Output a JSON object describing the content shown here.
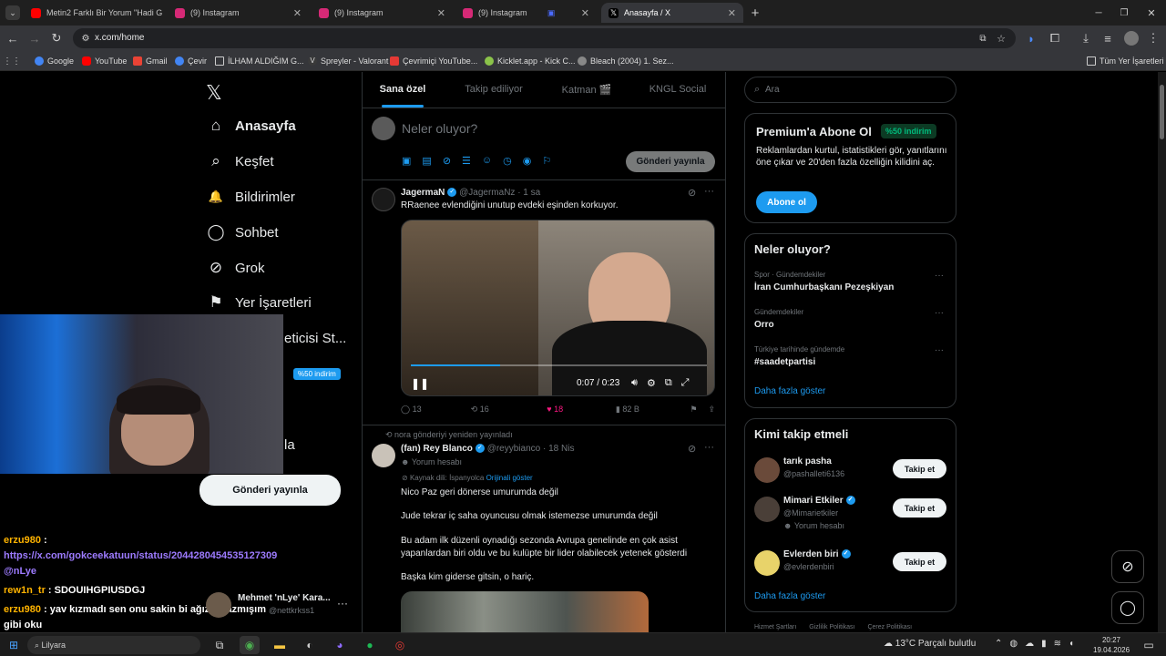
{
  "browser": {
    "tabs": [
      {
        "title": "Metin2 Farklı Bir Yorum \"Hadi G",
        "color": "#ff0000"
      },
      {
        "title": "(9) Instagram",
        "color": "#d62976"
      },
      {
        "title": "(9) Instagram",
        "color": "#d62976"
      },
      {
        "title": "(9) Instagram",
        "color": "#d62976"
      },
      {
        "title": "Anasayfa / X",
        "color": "#000000"
      }
    ],
    "url": "x.com/home",
    "bookmarks": [
      "Google",
      "YouTube",
      "Gmail",
      "Çevir",
      "İLHAM ALDIĞIM G...",
      "Spreyler - Valorant",
      "Çevrimiçi YouTube...",
      "Kicklet.app - Kick C...",
      "Bleach (2004) 1. Sez..."
    ],
    "all_bookmarks": "Tüm Yer İşaretleri"
  },
  "sidebar": {
    "logo": "𝕏",
    "items": [
      {
        "label": "Anasayfa",
        "icon": "⌂"
      },
      {
        "label": "Keşfet",
        "icon": "⌕"
      },
      {
        "label": "Bildirimler",
        "icon": "🔔"
      },
      {
        "label": "Sohbet",
        "icon": "◯"
      },
      {
        "label": "Grok",
        "icon": "⊘"
      },
      {
        "label": "Yer İşaretleri",
        "icon": "⚑"
      }
    ],
    "partial_item": "eticisi St...",
    "discount_badge": "%50 indirim",
    "partial_profile": "la",
    "post_button": "Gönderi yayınla"
  },
  "feed_tabs": [
    "Sana özel",
    "Takip ediliyor",
    "Katman 🎬",
    "KNGL Social"
  ],
  "composer": {
    "placeholder": "Neler oluyor?",
    "post_button": "Gönderi yayınla"
  },
  "tweet1": {
    "name": "JagermaN",
    "handle": "@JagermaNz",
    "time": "· 1 sa",
    "text": "RRaenee evlendiğini unutup evdeki eşinden korkuyor.",
    "video_time": "0:07 / 0:23",
    "progress": 0.3,
    "replies": "13",
    "retweets": "16",
    "likes": "18",
    "views": "82 B"
  },
  "tweet2": {
    "retweeted_by": "nora gönderiyi yeniden yayınladı",
    "name": "(fan) Rey Blanco",
    "handle": "@reyybianco",
    "time": "· 18 Nis",
    "badge": "Yorum hesabı",
    "source_lang": "Kaynak dili: İspanyolca",
    "show_original": "Orijinali göster",
    "lines": [
      "Nico Paz geri dönerse umurumda değil",
      "Jude tekrar iç saha oyuncusu olmak istemezse umurumda değil",
      "Bu adam ilk düzenli oynadığı sezonda Avrupa genelinde en çok asist yapanlardan biri oldu ve bu kulüpte bir lider olabilecek yetenek gösterdi",
      "Başka kim giderse gitsin, o hariç."
    ]
  },
  "right": {
    "search_placeholder": "Ara",
    "premium": {
      "title": "Premium'a Abone Ol",
      "badge": "%50 indirim",
      "text": "Reklamlardan kurtul, istatistikleri gör, yanıtlarını öne çıkar ve 20'den fazla özelliğin kilidini aç.",
      "button": "Abone ol"
    },
    "trends": {
      "title": "Neler oluyor?",
      "items": [
        {
          "category": "Spor · Gündemdekiler",
          "name": "İran Cumhurbaşkanı Pezeşkiyan"
        },
        {
          "category": "Gündemdekiler",
          "name": "Orro"
        },
        {
          "category": "Türkiye tarihinde gündemde",
          "name": "#saadetpartisi"
        }
      ],
      "more": "Daha fazla göster"
    },
    "follow": {
      "title": "Kimi takip etmeli",
      "items": [
        {
          "name": "tarık pasha",
          "handle": "@pashalleti6136",
          "sub": ""
        },
        {
          "name": "Mimari Etkiler",
          "handle": "@Mimarietkiler",
          "sub": "Yorum hesabı"
        },
        {
          "name": "Evlerden biri",
          "handle": "@evlerdenbiri",
          "sub": ""
        }
      ],
      "button": "Takip et",
      "more": "Daha fazla göster"
    },
    "footer": [
      "Hizmet Şartları",
      "Gizlilik Politikası",
      "Çerez Politikası"
    ]
  },
  "profile_popup": {
    "name": "Mehmet 'nLye' Kara...",
    "handle": "@nettkrkss1"
  },
  "chat": [
    {
      "user": "erzu980",
      "color": "#ffb300",
      "text": "",
      "link": "https://x.com/gokceekatuun/status/2044280454535127309 @nLye"
    },
    {
      "user": "rew1n_tr",
      "color": "#ffb300",
      "text": "SDOUIHGPIUSDGJ",
      "link": ""
    },
    {
      "user": "erzu980",
      "color": "#ffb300",
      "text": "yav kızmadı sen onu sakin bi ağızla yazmışım gibi oku",
      "link": ""
    }
  ],
  "taskbar": {
    "weather": "13°C  Parçalı bulutlu",
    "time": "20:27",
    "date": "19.04.2026",
    "search_text": "Lilyara"
  }
}
